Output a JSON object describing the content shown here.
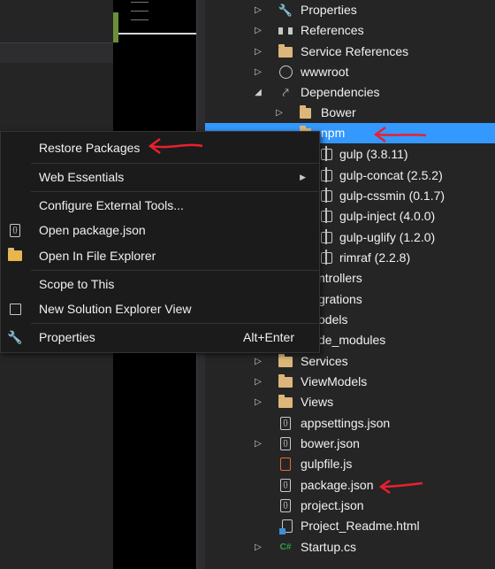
{
  "explorer": {
    "items": [
      {
        "label": "Properties",
        "icon": "wrench-icon"
      },
      {
        "label": "References",
        "icon": "references-icon"
      },
      {
        "label": "Service References",
        "icon": "folder-icon"
      },
      {
        "label": "wwwroot",
        "icon": "globe-icon"
      },
      {
        "label": "Dependencies",
        "icon": "dependencies-icon"
      },
      {
        "label": "Bower",
        "icon": "package-icon"
      },
      {
        "label": "npm",
        "icon": "package-icon"
      },
      {
        "label": "gulp (3.8.11)",
        "icon": "package-icon"
      },
      {
        "label": "gulp-concat (2.5.2)",
        "icon": "package-icon"
      },
      {
        "label": "gulp-cssmin (0.1.7)",
        "icon": "package-icon"
      },
      {
        "label": "gulp-inject (4.0.0)",
        "icon": "package-icon"
      },
      {
        "label": "gulp-uglify (1.2.0)",
        "icon": "package-icon"
      },
      {
        "label": "rimraf (2.2.8)",
        "icon": "package-icon"
      },
      {
        "label": "ntrollers",
        "icon": "folder-icon"
      },
      {
        "label": "grations",
        "icon": "folder-icon"
      },
      {
        "label": "odels",
        "icon": "folder-icon"
      },
      {
        "label": "de_modules",
        "icon": "folder-icon"
      },
      {
        "label": "Services",
        "icon": "folder-icon"
      },
      {
        "label": "ViewModels",
        "icon": "folder-icon"
      },
      {
        "label": "Views",
        "icon": "folder-icon"
      },
      {
        "label": "appsettings.json",
        "icon": "json-file-icon"
      },
      {
        "label": "bower.json",
        "icon": "json-file-icon"
      },
      {
        "label": "gulpfile.js",
        "icon": "js-file-icon"
      },
      {
        "label": "package.json",
        "icon": "json-file-icon"
      },
      {
        "label": "project.json",
        "icon": "json-file-icon"
      },
      {
        "label": "Project_Readme.html",
        "icon": "html-file-icon"
      },
      {
        "label": "Startup.cs",
        "icon": "csharp-file-icon"
      }
    ]
  },
  "context_menu": {
    "items": [
      {
        "label": "Restore Packages"
      },
      {
        "label": "Web Essentials"
      },
      {
        "label": "Configure External Tools..."
      },
      {
        "label": "Open package.json",
        "icon": "npm-json-icon"
      },
      {
        "label": "Open In File Explorer",
        "icon": "file-explorer-icon"
      },
      {
        "label": "Scope to This"
      },
      {
        "label": "New Solution Explorer View",
        "icon": "new-view-icon"
      },
      {
        "label": "Properties",
        "icon": "wrench-icon",
        "shortcut": "Alt+Enter"
      }
    ]
  },
  "colors": {
    "selection": "#3399ff",
    "annotation_arrow": "#e8212e",
    "folder": "#dcb67a"
  }
}
